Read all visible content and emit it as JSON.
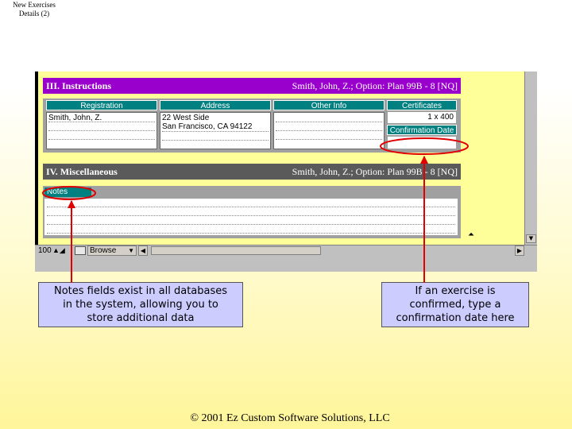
{
  "slide": {
    "title_line1": "New Exercises",
    "title_line2": "Details (2)",
    "footer": "© 2001 Ez Custom Software Solutions, LLC"
  },
  "sections": {
    "instructions": {
      "title": "III. Instructions",
      "record": "Smith, John, Z.; Option: Plan 99B - 8 [NQ]"
    },
    "miscellaneous": {
      "title": "IV. Miscellaneous",
      "record": "Smith, John, Z.; Option: Plan 99B - 8 [NQ]"
    }
  },
  "table": {
    "headers": {
      "registration": "Registration",
      "address": "Address",
      "other_info": "Other Info",
      "certificates": "Certificates"
    },
    "registration_value": "Smith, John, Z.",
    "address_line1": "22 West Side",
    "address_line2": "San Francisco, CA  94122",
    "certificates_value": "1 x 400",
    "confirmation_date_label": "Confirmation Date",
    "confirmation_date_value": ""
  },
  "notes": {
    "label": "Notes"
  },
  "statusbar": {
    "zoom": "100",
    "mode": "Browse"
  },
  "callouts": {
    "notes": {
      "line1": "Notes fields exist in all databases",
      "line2": "in the system, allowing you to",
      "line3": "store additional data"
    },
    "confirmation": {
      "line1": "If an exercise is",
      "line2": "confirmed, type a",
      "line3": "confirmation date here"
    }
  },
  "colors": {
    "instructions_header": "#9900cc",
    "misc_header": "#5a5a5a",
    "field_label": "#008080",
    "layout_background": "#ffff99",
    "callout_fill": "#ccccff",
    "annotation": "#e00000"
  },
  "icons": {
    "scroll_down": "triangle-down-icon",
    "scroll_top": "jump-to-top-icon",
    "scroll_left": "triangle-left-icon",
    "scroll_right": "triangle-right-icon",
    "mode_dropdown": "chevron-down-icon"
  }
}
